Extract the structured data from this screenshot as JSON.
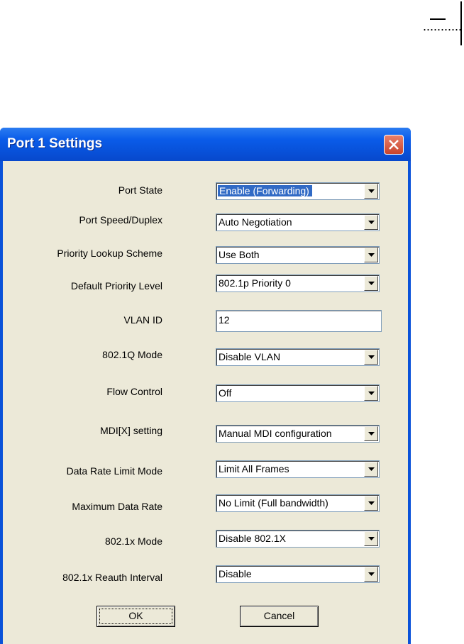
{
  "dialog": {
    "title": "Port 1 Settings"
  },
  "icons": {
    "close": "close-icon",
    "dropdown": "chevron-down-icon"
  },
  "colors": {
    "titlebar": "#0a5ce9",
    "client_bg": "#ece9d8",
    "selection": "#316ac5",
    "close_button": "#d05a40"
  },
  "fields": {
    "port_state": {
      "label": "Port State",
      "value": "Enable (Forwarding)"
    },
    "port_speed": {
      "label": "Port Speed/Duplex",
      "value": "Auto Negotiation"
    },
    "priority_lookup": {
      "label": "Priority Lookup Scheme",
      "value": "Use Both"
    },
    "default_priority": {
      "label": "Default Priority Level",
      "value": "802.1p Priority 0"
    },
    "vlan_id": {
      "label": "VLAN ID",
      "value": "12"
    },
    "dot1q_mode": {
      "label": "802.1Q Mode",
      "value": "Disable VLAN"
    },
    "flow_control": {
      "label": "Flow Control",
      "value": "Off"
    },
    "mdix": {
      "label": "MDI[X] setting",
      "value": "Manual MDI configuration"
    },
    "rate_limit_mode": {
      "label": "Data Rate Limit Mode",
      "value": "Limit All Frames"
    },
    "max_data_rate": {
      "label": "Maximum Data Rate",
      "value": "No Limit (Full bandwidth)"
    },
    "dot1x_mode": {
      "label": "802.1x Mode",
      "value": "Disable 802.1X"
    },
    "reauth_interval": {
      "label": "802.1x Reauth Interval",
      "value": "Disable"
    }
  },
  "buttons": {
    "ok": "OK",
    "cancel": "Cancel"
  }
}
